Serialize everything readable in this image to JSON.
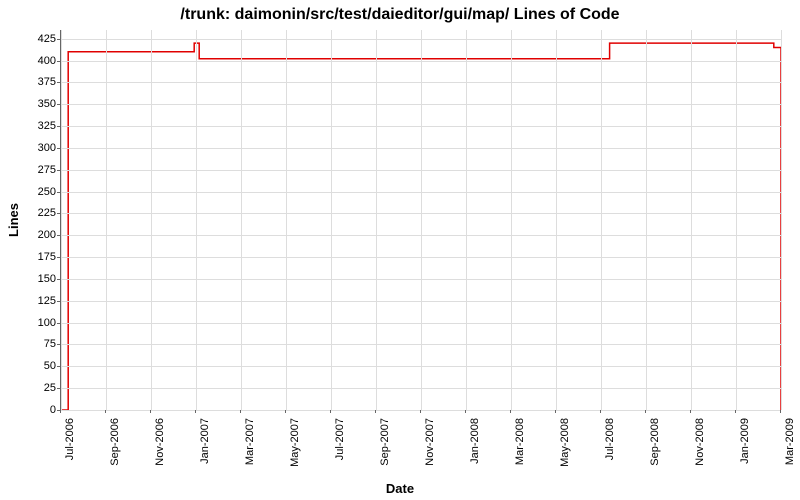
{
  "chart_data": {
    "type": "line",
    "title": "/trunk: daimonin/src/test/daieditor/gui/map/ Lines of Code",
    "xlabel": "Date",
    "ylabel": "Lines",
    "ylim": [
      0,
      435
    ],
    "y_ticks": [
      0,
      25,
      50,
      75,
      100,
      125,
      150,
      175,
      200,
      225,
      250,
      275,
      300,
      325,
      350,
      375,
      400,
      425
    ],
    "x_ticks": [
      "Jul-2006",
      "Sep-2006",
      "Nov-2006",
      "Jan-2007",
      "Mar-2007",
      "May-2007",
      "Jul-2007",
      "Sep-2007",
      "Nov-2007",
      "Jan-2008",
      "Mar-2008",
      "May-2008",
      "Jul-2008",
      "Sep-2008",
      "Nov-2008",
      "Jan-2009",
      "Mar-2009"
    ],
    "x": [
      0,
      0.01,
      0.179,
      0.185,
      0.192,
      0.755,
      0.762,
      0.985,
      0.99,
      1.0
    ],
    "values": [
      0,
      410,
      410,
      420,
      402,
      402,
      420,
      420,
      415,
      0
    ],
    "line_color": "#e00000"
  }
}
